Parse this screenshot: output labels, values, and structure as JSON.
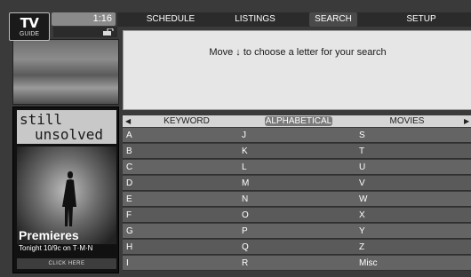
{
  "logo": {
    "line1": "TV",
    "line2": "GUIDE"
  },
  "clock": "1:16",
  "nav": {
    "tabs": [
      {
        "label": "SCHEDULE"
      },
      {
        "label": "LISTINGS"
      },
      {
        "label": "SEARCH"
      },
      {
        "label": "SETUP"
      }
    ],
    "active_tab": "SEARCH"
  },
  "instruction": "Move ↓ to choose a letter for your search",
  "ad": {
    "headline_line1": "still",
    "headline_line2": "unsolved",
    "promo_title": "Premieres",
    "promo_line": "Tonight 10/9c on T·M·N",
    "cta": "CLICK HERE"
  },
  "modes": [
    {
      "label": "KEYWORD"
    },
    {
      "label": "ALPHABETICAL"
    },
    {
      "label": "MOVIES"
    }
  ],
  "active_mode": "ALPHABETICAL",
  "letters": [
    [
      "A",
      "J",
      "S"
    ],
    [
      "B",
      "K",
      "T"
    ],
    [
      "C",
      "L",
      "U"
    ],
    [
      "D",
      "M",
      "V"
    ],
    [
      "E",
      "N",
      "W"
    ],
    [
      "F",
      "O",
      "X"
    ],
    [
      "G",
      "P",
      "Y"
    ],
    [
      "H",
      "Q",
      "Z"
    ],
    [
      "I",
      "R",
      "Misc"
    ]
  ],
  "colors": {
    "panel": "#e6e6e6",
    "grid_cell": "#646464",
    "background": "#3a3a3a"
  },
  "icons": {
    "lock": "lock-icon",
    "left": "arrow-left-icon",
    "right": "arrow-right-icon"
  }
}
